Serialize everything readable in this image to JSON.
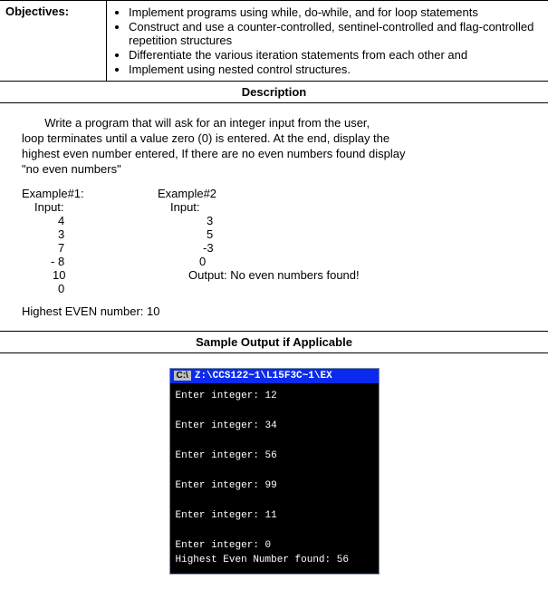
{
  "objectives": {
    "label": "Objectives:",
    "items": [
      "Implement programs using while, do-while, and for loop statements",
      "Construct and use a counter-controlled, sentinel-controlled and flag-controlled repetition structures",
      "Differentiate the various iteration statements from each other and",
      "Implement using nested control structures."
    ]
  },
  "description_header": "Description",
  "description": {
    "p1": "       Write a program that will ask for an integer input from the user,",
    "p2": "loop terminates until a value zero (0) is entered.  At the end, display the",
    "p3": "highest even number entered, If there are no even numbers found display",
    "p4": "\"no even numbers\""
  },
  "example1": {
    "title": "Example#1:",
    "input_label": "Input:",
    "nums": [
      "4",
      "3",
      "7",
      "- 8",
      "10",
      "0"
    ],
    "result": "Highest EVEN number:  10"
  },
  "example2": {
    "title": "Example#2",
    "input_label": "Input:",
    "nums": [
      "3",
      "5",
      "-3",
      "0"
    ],
    "result": "Output: No even numbers found!"
  },
  "sample_header": "Sample Output if Applicable",
  "terminal": {
    "title_prefix": "C:\\",
    "title_path": "Z:\\CCS122~1\\L15F3C~1\\EX",
    "lines": [
      "Enter integer: 12",
      "Enter integer: 34",
      "Enter integer: 56",
      "Enter integer: 99",
      "Enter integer: 11",
      "Enter integer: 0",
      "Highest Even Number found: 56"
    ]
  }
}
